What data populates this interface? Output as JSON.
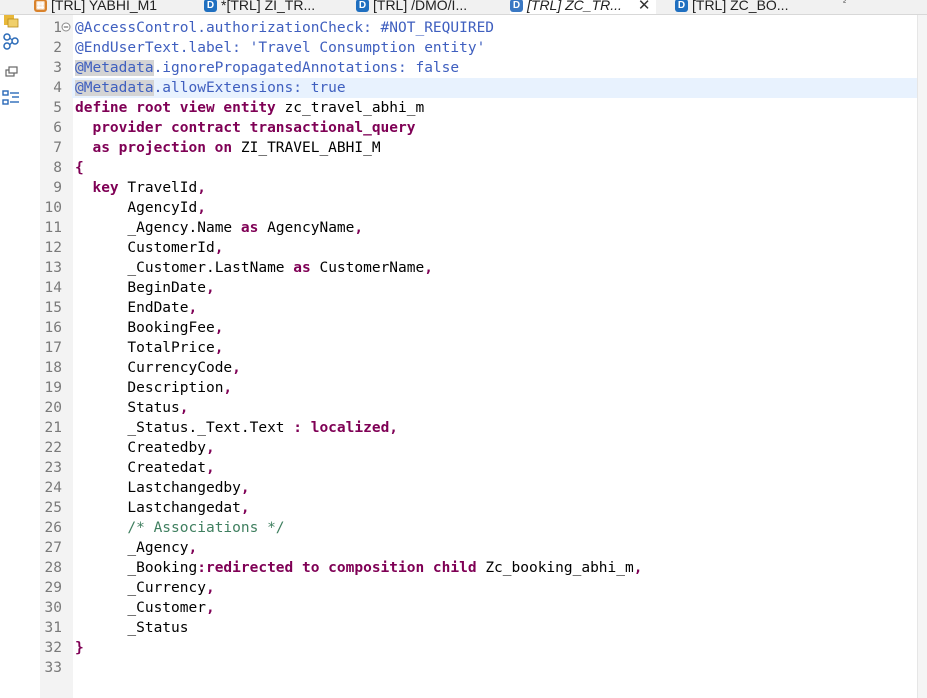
{
  "tabs": [
    {
      "label": "[TRL] YABHI_M1",
      "icon": "table-icon",
      "active": false
    },
    {
      "label": "*[TRL] ZI_TR...",
      "icon": "ddl-icon",
      "active": false
    },
    {
      "label": "[TRL] /DMO/I...",
      "icon": "ddl-icon",
      "active": false
    },
    {
      "label": "[TRL] ZC_TR...",
      "icon": "ddl-icon",
      "active": true
    },
    {
      "label": "[TRL] ZC_BO...",
      "icon": "ddl-icon",
      "active": false
    }
  ],
  "tab_overflow": "²",
  "line_numbers": [
    "1",
    "2",
    "3",
    "4",
    "5",
    "6",
    "7",
    "8",
    "9",
    "10",
    "11",
    "12",
    "13",
    "14",
    "15",
    "16",
    "17",
    "18",
    "19",
    "20",
    "21",
    "22",
    "23",
    "24",
    "25",
    "26",
    "27",
    "28",
    "29",
    "30",
    "31",
    "32",
    "33"
  ],
  "code_lines": {
    "l1": "@AccessControl.authorizationCheck: #NOT_REQUIRED",
    "l2": "@EndUserText.label: 'Travel Consumption entity'",
    "l3a": "@Metadata",
    "l3b": ".ignorePropagatedAnnotations: false",
    "l4a": "@Metadata",
    "l4b": ".allowExtensions: true",
    "l5a": "define root view entity",
    "l5b": " zc_travel_abhi_m",
    "l6": "provider contract transactional_query",
    "l7a": "as projection on",
    "l7b": " ZI_TRAVEL_ABHI_M",
    "l8": "{",
    "l9a": "key",
    "l9b": " TravelId",
    "l9c": ",",
    "l10a": "AgencyId",
    "l10b": ",",
    "l11a": "_Agency.Name ",
    "l11b": "as",
    "l11c": " AgencyName",
    "l11d": ",",
    "l12a": "CustomerId",
    "l12b": ",",
    "l13a": "_Customer.LastName ",
    "l13b": "as",
    "l13c": " CustomerName",
    "l13d": ",",
    "l14a": "BeginDate",
    "l14b": ",",
    "l15a": "EndDate",
    "l15b": ",",
    "l16a": "BookingFee",
    "l16b": ",",
    "l17a": "TotalPrice",
    "l17b": ",",
    "l18a": "CurrencyCode",
    "l18b": ",",
    "l19a": "Description",
    "l19b": ",",
    "l20a": "Status",
    "l20b": ",",
    "l21a": "_Status._Text.Text ",
    "l21b": ": localized",
    "l21c": ",",
    "l22a": "Createdby",
    "l22b": ",",
    "l23a": "Createdat",
    "l23b": ",",
    "l24a": "Lastchangedby",
    "l24b": ",",
    "l25a": "Lastchangedat",
    "l25b": ",",
    "l26": "/* Associations */",
    "l27a": "_Agency",
    "l27b": ",",
    "l28a": "_Booking",
    "l28b": ":redirected to composition child",
    "l28c": " Zc_booking_abhi_m",
    "l28d": ",",
    "l29a": "_Currency",
    "l29b": ",",
    "l30a": "_Customer",
    "l30b": ",",
    "l31": "_Status",
    "l32": "}",
    "l33": ""
  },
  "colors": {
    "annotation": "#3f5fbf",
    "keyword": "#7f0055",
    "string": "#2a00ff",
    "comment": "#3f7f5f",
    "current_line": "#e8f2fe"
  }
}
